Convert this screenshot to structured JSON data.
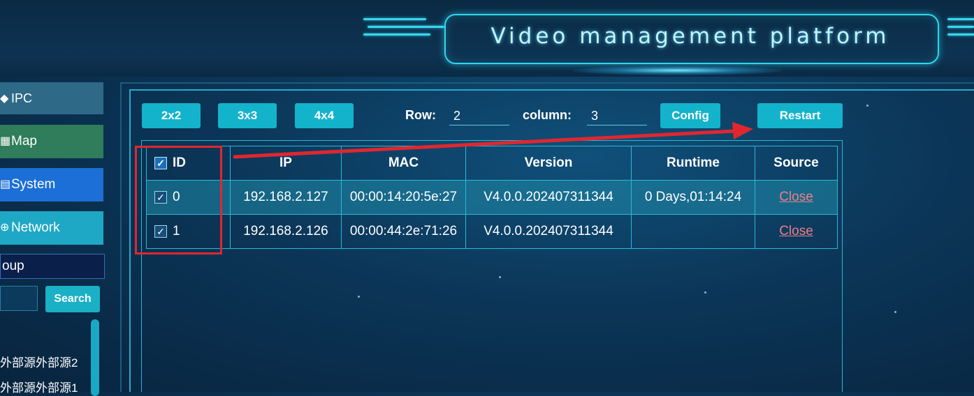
{
  "header": {
    "title": "Video management platform"
  },
  "sidebar": {
    "items": [
      {
        "label": "IPC",
        "icon": "video-camera-icon"
      },
      {
        "label": "Map",
        "icon": "map-icon"
      },
      {
        "label": "System",
        "icon": "system-icon"
      },
      {
        "label": "Network",
        "icon": "globe-icon"
      }
    ],
    "group_label": "oup",
    "search_label": "Search",
    "tree": [
      "外部源外部源2",
      "外部源外部源1"
    ]
  },
  "toolbar": {
    "layouts": [
      "2x2",
      "3x3",
      "4x4"
    ],
    "row_label": "Row:",
    "row_value": "2",
    "column_label": "column:",
    "column_value": "3",
    "config_label": "Config",
    "restart_label": "Restart"
  },
  "table": {
    "headers": [
      "ID",
      "IP",
      "MAC",
      "Version",
      "Runtime",
      "Source"
    ],
    "rows": [
      {
        "id": "0",
        "ip": "192.168.2.127",
        "mac": "00:00:14:20:5e:27",
        "version": "V4.0.0.202407311344",
        "runtime": "0 Days,01:14:24",
        "source": "Close",
        "checked": true
      },
      {
        "id": "1",
        "ip": "192.168.2.126",
        "mac": "00:00:44:2e:71:26",
        "version": "V4.0.0.202407311344",
        "runtime": "",
        "source": "Close",
        "checked": true
      }
    ]
  },
  "colors": {
    "accent": "#14b3cc",
    "annotation": "#e0272f",
    "close_link": "#ef7d86",
    "system_active": "#1c6fd6"
  }
}
